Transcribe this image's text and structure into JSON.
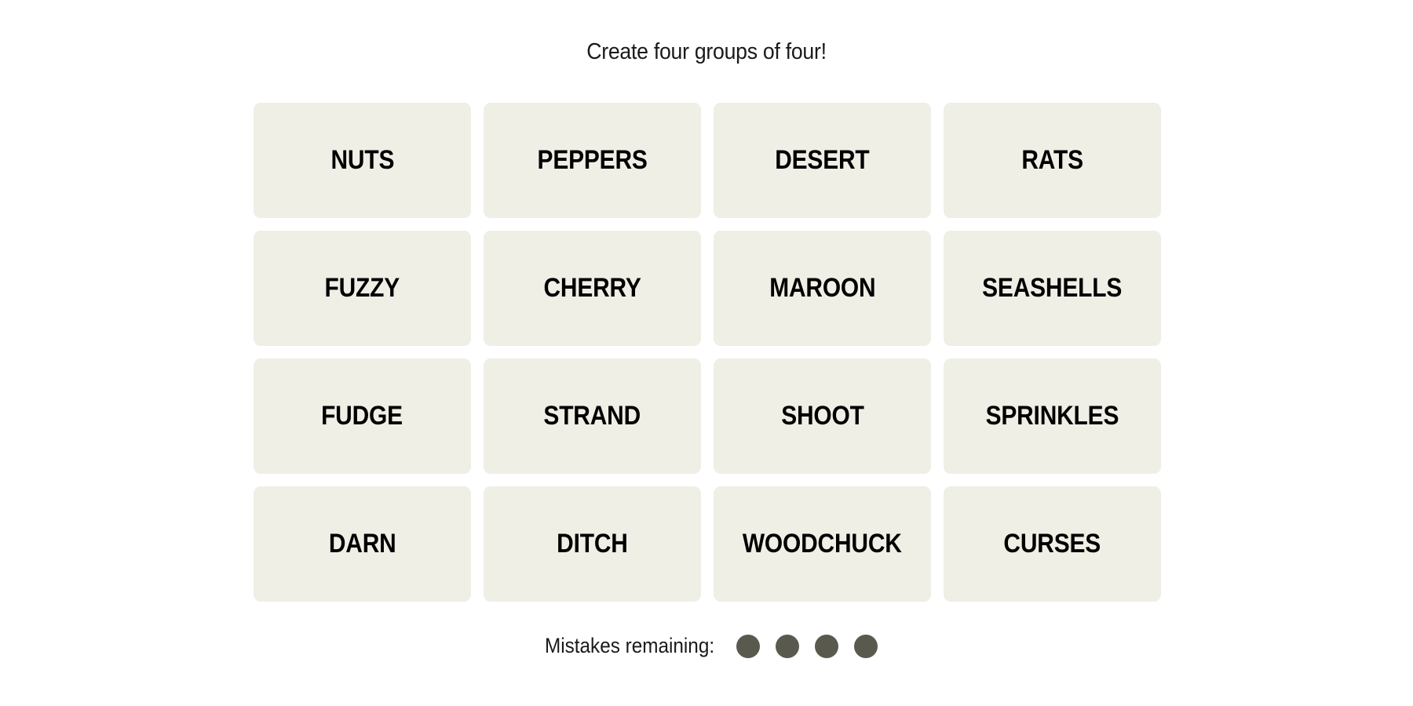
{
  "game": {
    "instructions": "Create four groups of four!",
    "tiles": [
      "NUTS",
      "PEPPERS",
      "DESERT",
      "RATS",
      "FUZZY",
      "CHERRY",
      "MAROON",
      "SEASHELLS",
      "FUDGE",
      "STRAND",
      "SHOOT",
      "SPRINKLES",
      "DARN",
      "DITCH",
      "WOODCHUCK",
      "CURSES"
    ],
    "mistakes_label": "Mistakes remaining:",
    "mistakes_remaining": 4,
    "colors": {
      "tile_bg": "#efefe6",
      "dot": "#5a594e"
    }
  }
}
